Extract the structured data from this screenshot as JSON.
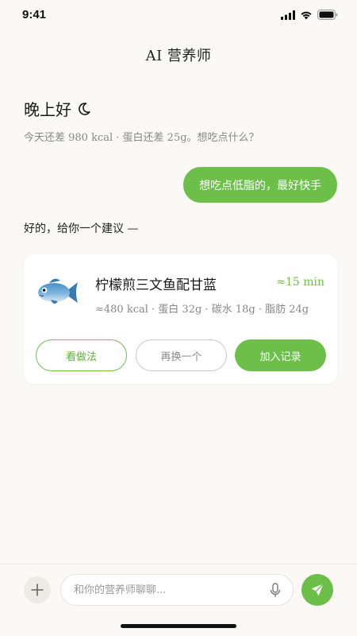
{
  "status_bar": {
    "time": "9:41"
  },
  "header": {
    "title": "AI 营养师"
  },
  "greeting": {
    "text": "晚上好",
    "icon": "moon-icon"
  },
  "subtitle": "今天还差 980 kcal · 蛋白还差 25g。想吃点什么？",
  "messages": {
    "user": "想吃点低脂的，最好快手",
    "ai": "好的，给你一个建议 —"
  },
  "suggestion_card": {
    "icon": "fish-icon",
    "name": "柠檬煎三文鱼配甘蓝",
    "time": "≈15 min",
    "macros": "≈480 kcal · 蛋白 32g · 碳水 18g · 脂肪 24g",
    "buttons": {
      "recipe": "看做法",
      "swap": "再换一个",
      "add": "加入记录"
    }
  },
  "composer": {
    "placeholder": "和你的营养师聊聊...",
    "value": ""
  },
  "colors": {
    "accent": "#6cc04a",
    "background": "#faf9f5",
    "muted_text": "#888888"
  }
}
